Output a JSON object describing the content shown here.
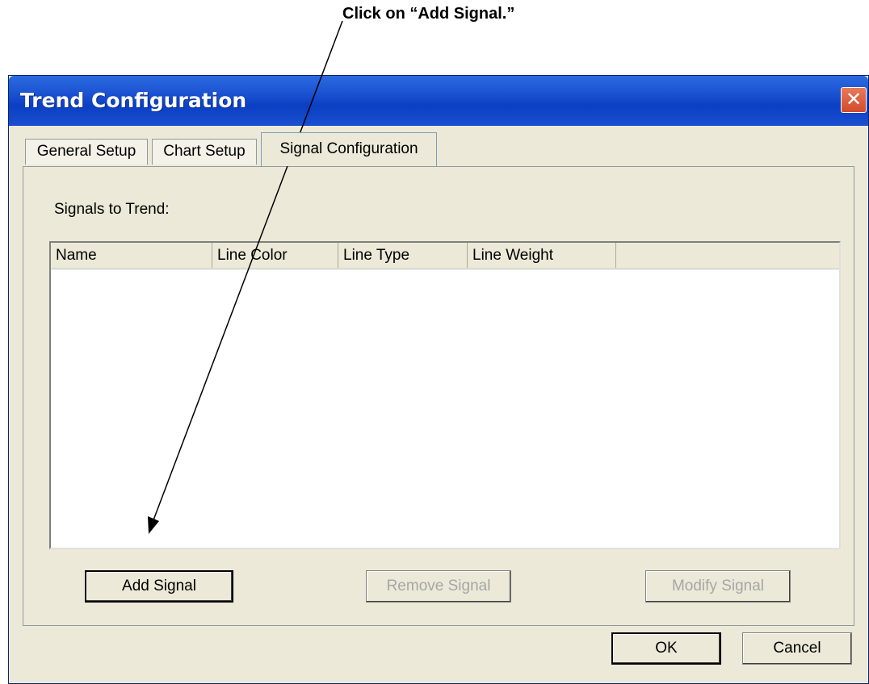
{
  "annotation": {
    "text": "Click on “Add Signal.”"
  },
  "window": {
    "title": "Trend Configuration",
    "close_glyph": "✕"
  },
  "tabs": [
    {
      "label": "General Setup"
    },
    {
      "label": "Chart Setup"
    },
    {
      "label": "Signal Configuration"
    }
  ],
  "panel": {
    "signals_label": "Signals to Trend:",
    "columns": [
      "Name",
      "Line Color",
      "Line Type",
      "Line Weight"
    ]
  },
  "buttons": {
    "add_signal": "Add Signal",
    "remove_signal": "Remove Signal",
    "modify_signal": "Modify Signal",
    "ok": "OK",
    "cancel": "Cancel"
  }
}
